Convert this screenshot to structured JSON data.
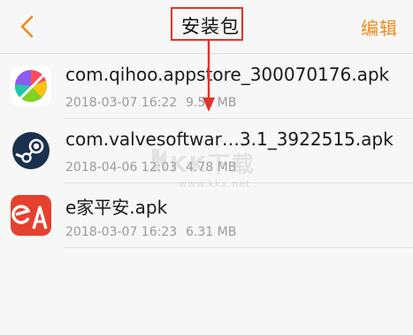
{
  "header": {
    "title": "安装包",
    "edit_label": "编辑",
    "back_icon": "chevron-left-icon",
    "accent_color": "#f08a1a",
    "highlight_color": "#e0342c"
  },
  "files": [
    {
      "name": "com.qihoo.appstore_300070176.apk",
      "date": "2018-03-07 16:22",
      "size": "9.52 MB",
      "icon": "app-store-icon"
    },
    {
      "name": "com.valvesoftwar…3.1_3922515.apk",
      "date": "2018-04-06 12:03",
      "size": "4.78 MB",
      "icon": "steam-icon"
    },
    {
      "name": "e家平安.apk",
      "date": "2018-03-07 16:23",
      "size": "6.31 MB",
      "icon": "e-home-icon"
    }
  ],
  "watermark": {
    "text": "KK下载",
    "url": "www.kkx.net"
  }
}
